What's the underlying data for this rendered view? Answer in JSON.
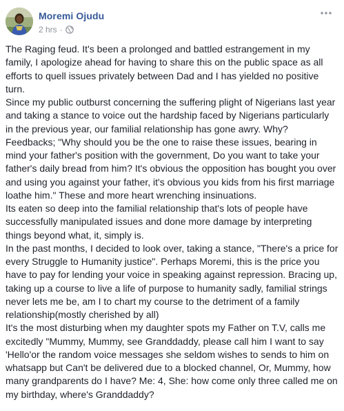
{
  "post": {
    "author": "Moremi Ojudu",
    "timestamp": "2 hrs",
    "separator": "·",
    "privacy_icon": "globe-icon",
    "options_icon": "more-options-icon",
    "paragraphs": [
      "The Raging feud. It's been a prolonged and battled estrangement in my family, I apologize ahead for having to share this on the public space as all efforts to quell issues privately between Dad and I has yielded no positive turn.",
      "Since my public outburst concerning the suffering plight of Nigerians last year and taking a stance to voice out the hardship faced by Nigerians particularly in the previous year, our familial relationship has gone awry. Why? Feedbacks; \"Why should you be the one to raise these issues, bearing in mind your father's position with the government, Do you want to take your father's daily bread from him? It's obvious the opposition has bought you over and using you against your father, it's obvious you kids from his first marriage loathe him.\" These and more heart wrenching insinuations.",
      "Its eaten so deep into the familial relationship that's lots of people have successfully manipulated issues and done more damage by interpreting things beyond what, it, simply is.",
      "In the past months, I decided to look over, taking a stance, \"There's a price for every Struggle to Humanity justice\". Perhaps Moremi, this is the price you have to pay for lending your voice in speaking against repression. Bracing up, taking up a course to live a life of purpose to humanity sadly, familial strings never lets me be, am I to chart my course to the detriment of a family relationship(mostly cherished by all)",
      "It's the most disturbing when my daughter spots my Father on T.V, calls me excitedly \"Mummy, Mummy, see Granddaddy, please call him I want to say 'Hello'or the random voice messages she seldom wishes to sends to him on whatsapp but Can't be delivered due to a blocked channel, Or, Mummy, how many grandparents do I have? Me: 4, She: how come only three called me on my birthday, where's Granddaddy?"
    ]
  },
  "colors": {
    "author_link": "#365899",
    "meta_text": "#90949c",
    "body_text": "#1d2129"
  }
}
